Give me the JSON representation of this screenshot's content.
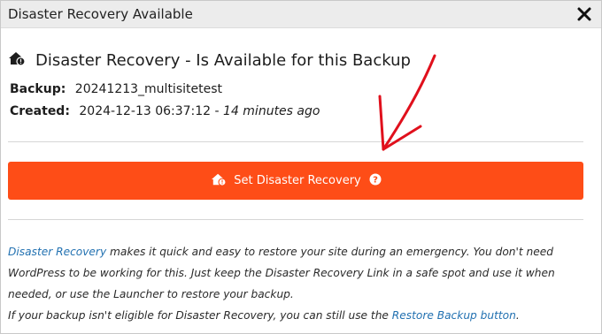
{
  "dialog": {
    "title": "Disaster Recovery Available",
    "heading": "Disaster Recovery - Is Available for this Backup",
    "backup_label": "Backup:",
    "backup_value": "20241213_multisitetest",
    "created_label": "Created:",
    "created_value": "2024-12-13 06:37:12 - ",
    "created_ago": "14 minutes ago",
    "button_label": "Set Disaster Recovery",
    "desc_link1": "Disaster Recovery",
    "desc_line1_rest": " makes it quick and easy to restore your site during an emergency. You don't need",
    "desc_line2": "WordPress to be working for this. Just keep the Disaster Recovery Link in a safe spot and use it when",
    "desc_line3": "needed, or use the Launcher to restore your backup.",
    "desc_line4_start": "If your backup isn't eligible for Disaster Recovery, you can still use the ",
    "desc_link2": "Restore Backup button",
    "desc_line4_end": "."
  },
  "icons": [
    "close-icon",
    "home-alert-icon",
    "help-icon",
    "annotation-arrow"
  ],
  "colors": {
    "button": "#fe4d17",
    "link": "#2271b1",
    "arrow": "#e0101c"
  }
}
